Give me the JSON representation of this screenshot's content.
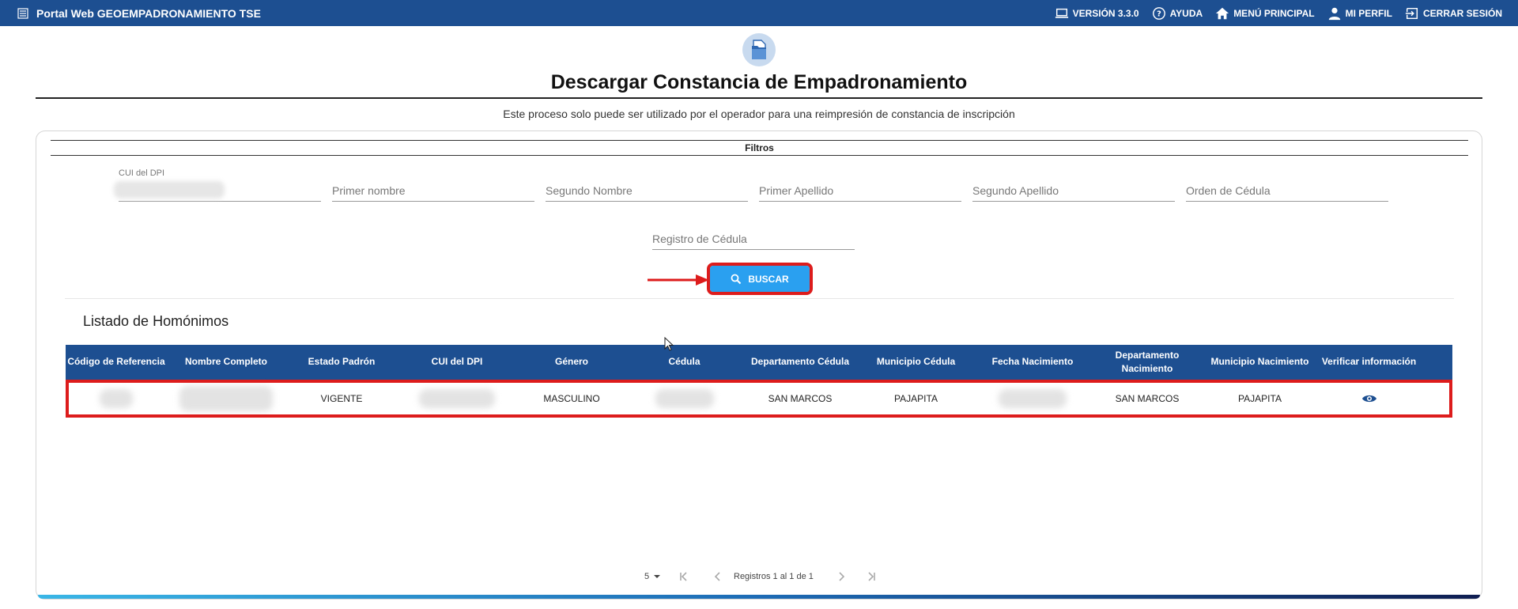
{
  "topbar": {
    "title": "Portal Web GEOEMPADRONAMIENTO TSE",
    "nav": [
      {
        "label": "VERSIÓN 3.3.0",
        "icon": "laptop-icon"
      },
      {
        "label": "AYUDA",
        "icon": "help-circle-icon"
      },
      {
        "label": "MENÚ PRINCIPAL",
        "icon": "home-icon"
      },
      {
        "label": "MI PERFIL",
        "icon": "person-icon"
      },
      {
        "label": "CERRAR SESIÓN",
        "icon": "logout-icon"
      }
    ]
  },
  "header": {
    "title": "Descargar Constancia de Empadronamiento",
    "subtitle": "Este proceso solo puede ser utilizado por el operador para una reimpresión de constancia de inscripción"
  },
  "filters": {
    "title": "Filtros",
    "cui_label": "CUI del DPI",
    "fields": {
      "primer_nombre": "Primer nombre",
      "segundo_nombre": "Segundo Nombre",
      "primer_apellido": "Primer Apellido",
      "segundo_apellido": "Segundo Apellido",
      "orden_cedula": "Orden de Cédula",
      "registro_cedula": "Registro de Cédula"
    },
    "search_button": "BUSCAR"
  },
  "list": {
    "title": "Listado de Homónimos",
    "columns": [
      "Código de Referencia",
      "Nombre Completo",
      "Estado Padrón",
      "CUI del DPI",
      "Género",
      "Cédula",
      "Departamento Cédula",
      "Municipio Cédula",
      "Fecha Nacimiento",
      "Departamento Nacimiento",
      "Municipio Nacimiento",
      "Verificar información"
    ],
    "rows": [
      {
        "estado": "VIGENTE",
        "genero": "MASCULINO",
        "depto_cedula": "SAN MARCOS",
        "muni_cedula": "PAJAPITA",
        "depto_nac": "SAN MARCOS",
        "muni_nac": "PAJAPITA"
      }
    ]
  },
  "paginator": {
    "page_size": "5",
    "range": "Registros 1 al 1 de 1"
  },
  "colors": {
    "primary": "#1d4f91",
    "button": "#2aa0f0",
    "highlight": "#dd1c1c"
  }
}
